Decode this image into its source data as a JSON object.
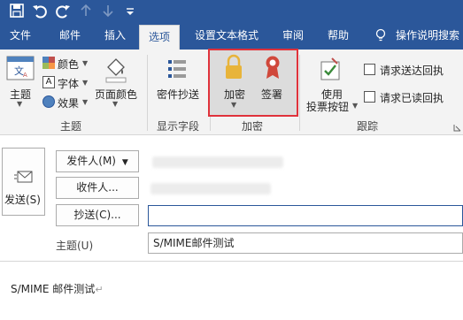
{
  "tabs": [
    {
      "label": "文件"
    },
    {
      "label": "邮件"
    },
    {
      "label": "插入"
    },
    {
      "label": "选项"
    },
    {
      "label": "设置文本格式"
    },
    {
      "label": "审阅"
    },
    {
      "label": "帮助"
    },
    {
      "label": "操作说明搜索"
    }
  ],
  "ribbon": {
    "themes": {
      "theme_label": "主题",
      "colors_label": "颜色",
      "fonts_label": "字体",
      "effects_label": "效果",
      "page_color_label": "页面颜色",
      "group_label": "主题"
    },
    "fields": {
      "bcc_label": "密件抄送",
      "group_label": "显示字段"
    },
    "encrypt": {
      "encrypt_label": "加密",
      "sign_label": "签署",
      "group_label": "加密"
    },
    "tracking": {
      "voting_label_1": "使用",
      "voting_label_2": "投票按钮",
      "delivery_receipt_label": "请求送达回执",
      "read_receipt_label": "请求已读回执",
      "group_label": "跟踪"
    }
  },
  "compose": {
    "send_label": "发送(S)",
    "from_label": "发件人(M)",
    "to_label": "收件人...",
    "cc_label": "抄送(C)...",
    "subject_label": "主题(U)",
    "subject_value": "S/MIME邮件测试",
    "body_text": "S/MIME 邮件测试"
  },
  "colors": {
    "accent": "#2b579a",
    "ribbon_bg": "#f3f3f3",
    "highlight_border": "#e0323b",
    "lock_gold": "#e8b43a",
    "ribbon_red": "#d0483b"
  }
}
